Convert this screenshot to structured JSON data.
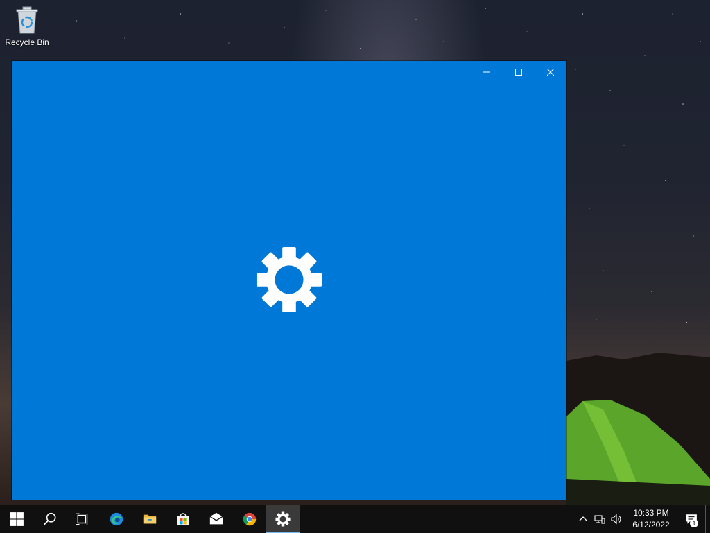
{
  "desktop": {
    "icons": [
      {
        "label": "Recycle Bin",
        "icon": "recycle-bin-icon"
      }
    ]
  },
  "window": {
    "app": "Settings",
    "background": "#0078d7",
    "splash_icon": "gear-icon",
    "controls": [
      "minimize-icon",
      "maximize-icon",
      "close-icon"
    ]
  },
  "taskbar": {
    "background": "#101010",
    "buttons": [
      {
        "name": "start",
        "icon": "windows-logo-icon"
      },
      {
        "name": "search",
        "icon": "search-icon"
      },
      {
        "name": "task-view",
        "icon": "task-view-icon"
      },
      {
        "name": "edge",
        "icon": "edge-icon"
      },
      {
        "name": "file-explorer",
        "icon": "folder-icon"
      },
      {
        "name": "store",
        "icon": "store-icon"
      },
      {
        "name": "mail",
        "icon": "mail-icon"
      },
      {
        "name": "chrome",
        "icon": "chrome-icon"
      },
      {
        "name": "settings",
        "icon": "gear-icon",
        "active": true
      }
    ],
    "tray": {
      "icons": [
        "chevron-up-icon",
        "network-icon",
        "volume-icon"
      ],
      "time": "10:33 PM",
      "date": "6/12/2022",
      "notification_count": "1"
    }
  }
}
